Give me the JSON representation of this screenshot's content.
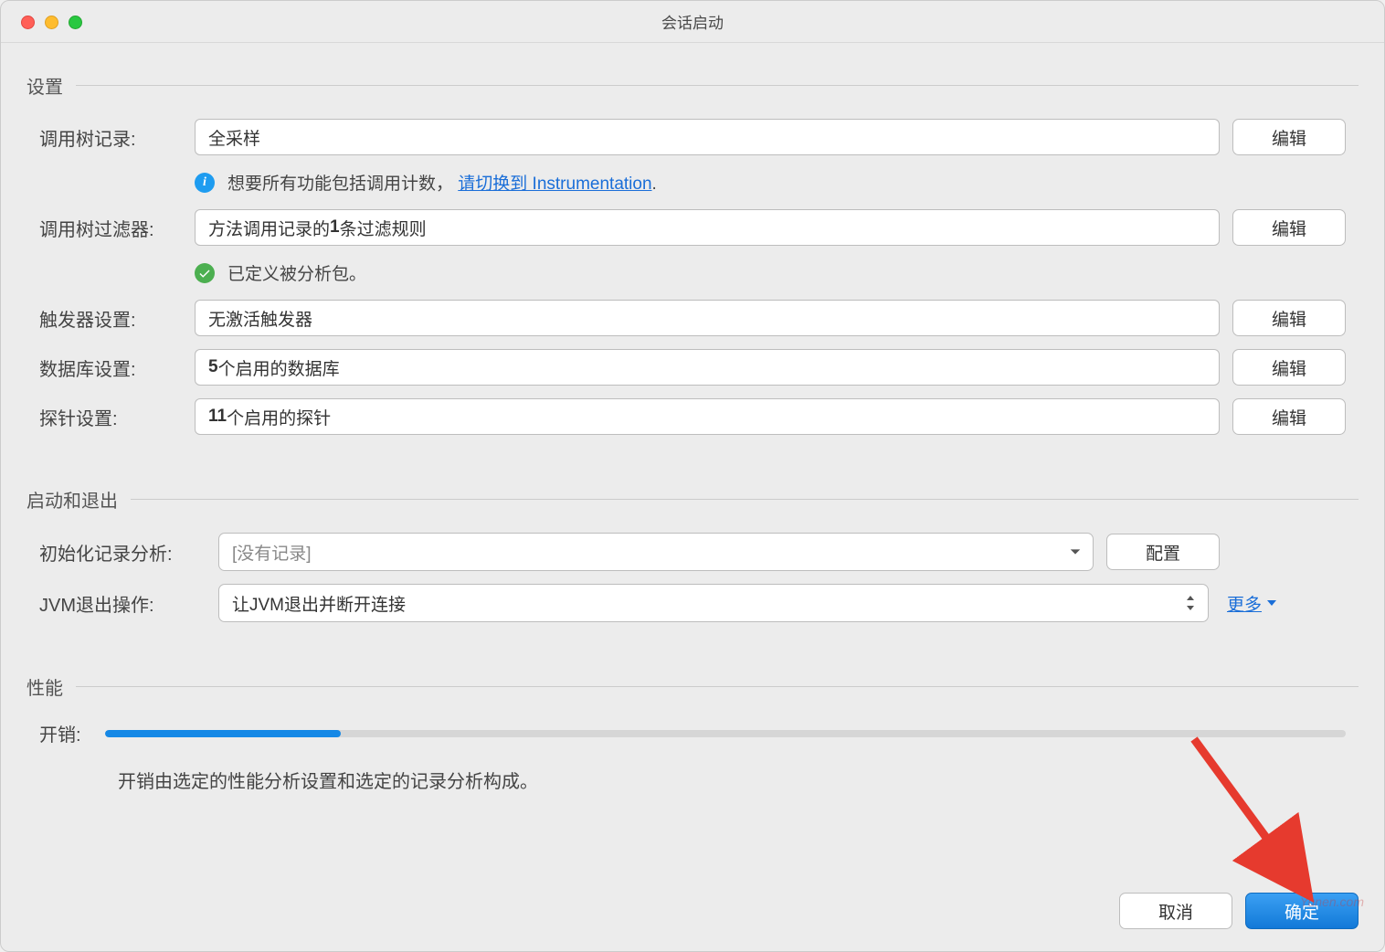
{
  "dialog": {
    "title": "会话启动"
  },
  "sections": {
    "settings": {
      "title": "设置",
      "call_tree_record": {
        "label": "调用树记录:",
        "value": "全采样",
        "edit": "编辑",
        "tip_prefix": "想要所有功能包括调用计数，  ",
        "tip_link": "请切换到 Instrumentation",
        "tip_suffix": "."
      },
      "call_tree_filter": {
        "label": "调用树过滤器:",
        "value_prefix": "方法调用记录的",
        "value_bold": "1",
        "value_suffix": "条过滤规则",
        "edit": "编辑",
        "check_text": "已定义被分析包。"
      },
      "trigger": {
        "label": "触发器设置:",
        "value": "无激活触发器",
        "edit": "编辑"
      },
      "database": {
        "label": "数据库设置:",
        "value_bold": "5",
        "value_suffix": "个启用的数据库",
        "edit": "编辑"
      },
      "probe": {
        "label": "探针设置:",
        "value_bold": "11",
        "value_suffix": "个启用的探针",
        "edit": "编辑"
      }
    },
    "startup": {
      "title": "启动和退出",
      "init_record": {
        "label": "初始化记录分析:",
        "placeholder": "[没有记录]",
        "configure": "配置"
      },
      "jvm_exit": {
        "label": "JVM退出操作:",
        "value": "让JVM退出并断开连接",
        "more": "更多"
      }
    },
    "performance": {
      "title": "性能",
      "overhead_label": "开销:",
      "overhead_percent": 19,
      "desc": "开销由选定的性能分析设置和选定的记录分析构成。"
    }
  },
  "footer": {
    "cancel": "取消",
    "ok": "确定"
  },
  "watermark": "Yunen.com"
}
